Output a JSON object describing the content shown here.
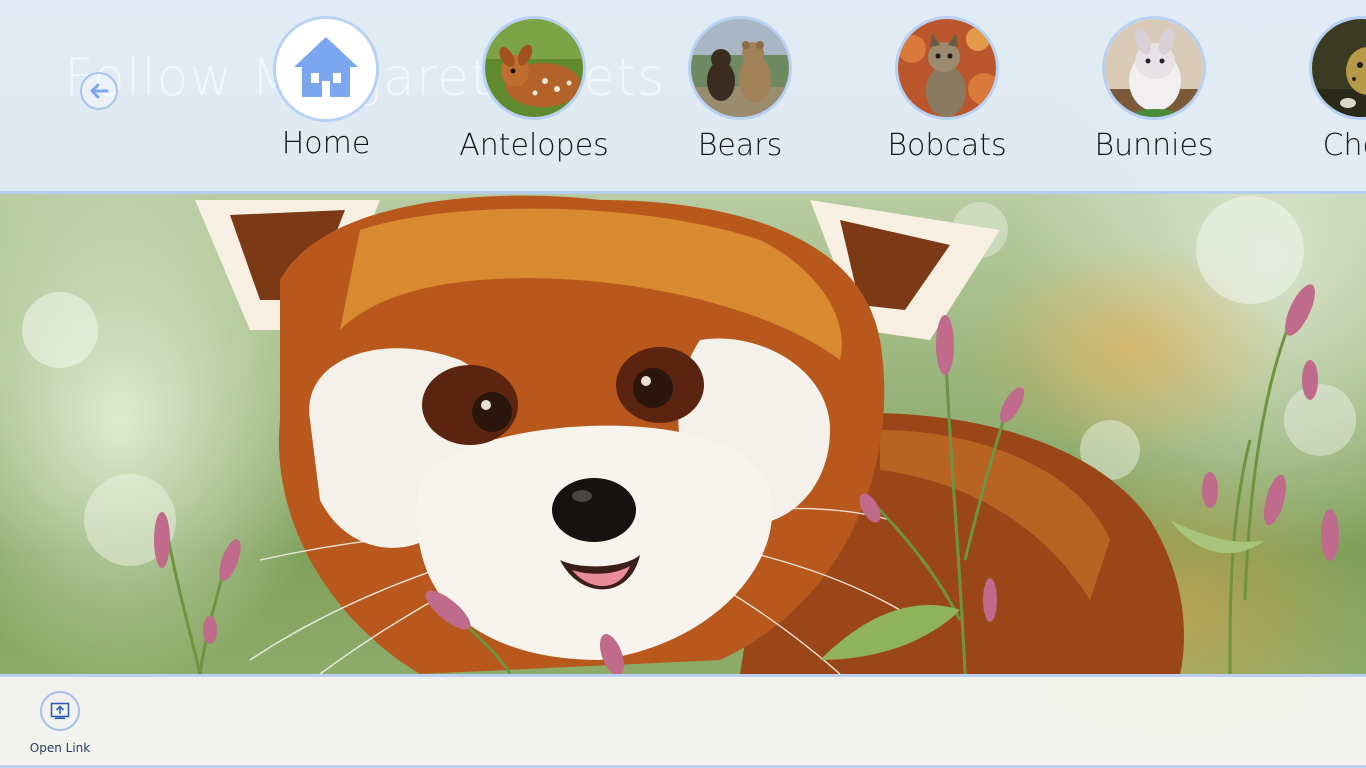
{
  "header": {
    "ghost_title": "Follow Margaret's Pets",
    "back_icon": "back-arrow-icon"
  },
  "nav": {
    "items": [
      {
        "label": "Home",
        "icon": "home-icon"
      },
      {
        "label": "Antelopes",
        "icon": "antelope-thumbnail"
      },
      {
        "label": "Bears",
        "icon": "bears-thumbnail"
      },
      {
        "label": "Bobcats",
        "icon": "bobcat-thumbnail"
      },
      {
        "label": "Bunnies",
        "icon": "bunny-thumbnail"
      },
      {
        "label": "Chee",
        "icon": "cheetah-thumbnail"
      }
    ]
  },
  "appbar": {
    "open_link_label": "Open Link",
    "open_link_icon": "open-link-icon"
  },
  "colors": {
    "accent": "#7aa7ee",
    "bar_border": "#b6cdf0",
    "topbar_bg": "#e2ecf8",
    "appbar_bg": "#f7f6f4"
  }
}
